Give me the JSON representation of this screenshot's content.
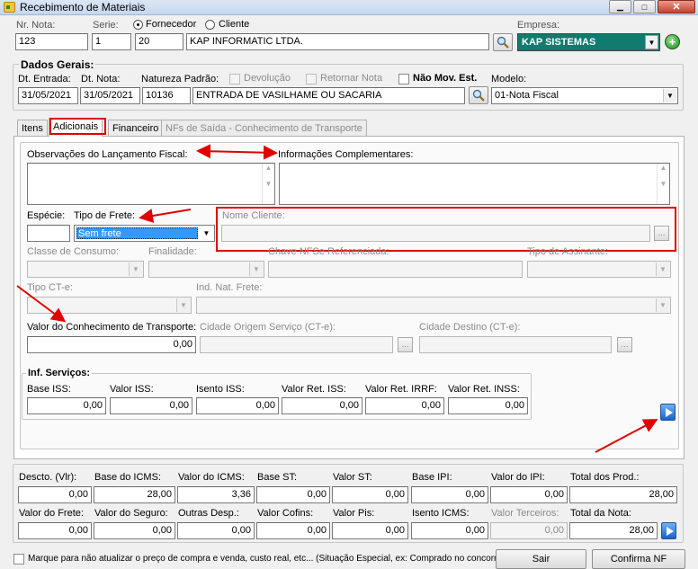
{
  "window": {
    "title": "Recebimento de Materiais"
  },
  "header": {
    "nr_nota_label": "Nr. Nota:",
    "nr_nota": "123",
    "serie_label": "Serie:",
    "serie": "1",
    "serie2": "20",
    "fornecedor_label": "Fornecedor",
    "cliente_label": "Cliente",
    "fornecedor_nome": "KAP INFORMATIC LTDA.",
    "empresa_label": "Empresa:",
    "empresa": "KAP SISTEMAS"
  },
  "dados_gerais": {
    "title": "Dados Gerais:",
    "dt_entrada_label": "Dt. Entrada:",
    "dt_entrada": "31/05/2021",
    "dt_nota_label": "Dt. Nota:",
    "dt_nota": "31/05/2021",
    "natureza_label": "Natureza Padrão:",
    "natureza_cod": "10136",
    "natureza_desc": "ENTRADA DE VASILHAME OU SACARIA",
    "devolucao_label": "Devolução",
    "retornar_label": "Retornar Nota",
    "nao_mov_label": "Não Mov. Est.",
    "modelo_label": "Modelo:",
    "modelo": "01-Nota Fiscal"
  },
  "tabs": [
    "Itens",
    "Adicionais",
    "Financeiro",
    "NFs de Saída - Conhecimento de Transporte"
  ],
  "adicionais": {
    "obs_label": "Observações do Lançamento Fiscal:",
    "info_label": "Informações Complementares:",
    "especie_label": "Espécie:",
    "frete_label": "Tipo de Frete:",
    "frete_value": "Sem frete",
    "nome_cliente_label": "Nome Cliente:",
    "classe_label": "Classe de Consumo:",
    "finalidade_label": "Finalidade:",
    "chave_label": "Chave NFSe Referenciada:",
    "assinante_label": "Tipo de Assinante:",
    "tipo_cte_label": "Tipo CT-e:",
    "ind_nat_label": "Ind. Nat. Frete:",
    "valor_cte_label": "Valor do Conhecimento de Transporte:",
    "valor_cte": "0,00",
    "cidade_origem_label": "Cidade Origem Serviço (CT-e):",
    "cidade_destino_label": "Cidade Destino (CT-e):"
  },
  "inf_servicos": {
    "title": "Inf. Serviços:",
    "fields": [
      {
        "label": "Base ISS:",
        "value": "0,00"
      },
      {
        "label": "Valor ISS:",
        "value": "0,00"
      },
      {
        "label": "Isento ISS:",
        "value": "0,00"
      },
      {
        "label": "Valor Ret. ISS:",
        "value": "0,00"
      },
      {
        "label": "Valor Ret. IRRF:",
        "value": "0,00"
      },
      {
        "label": "Valor Ret. INSS:",
        "value": "0,00"
      }
    ]
  },
  "totais": {
    "row1": [
      {
        "label": "Descto. (Vlr):",
        "value": "0,00"
      },
      {
        "label": "Base do ICMS:",
        "value": "28,00"
      },
      {
        "label": "Valor do ICMS:",
        "value": "3,36"
      },
      {
        "label": "Base ST:",
        "value": "0,00"
      },
      {
        "label": "Valor ST:",
        "value": "0,00"
      },
      {
        "label": "Base IPI:",
        "value": "0,00"
      },
      {
        "label": "Valor do IPI:",
        "value": "0,00"
      },
      {
        "label": "Total dos Prod.:",
        "value": "28,00"
      }
    ],
    "row2": [
      {
        "label": "Valor do Frete:",
        "value": "0,00"
      },
      {
        "label": "Valor do Seguro:",
        "value": "0,00"
      },
      {
        "label": "Outras Desp.:",
        "value": "0,00"
      },
      {
        "label": "Valor Cofins:",
        "value": "0,00"
      },
      {
        "label": "Valor Pis:",
        "value": "0,00"
      },
      {
        "label": "Isento ICMS:",
        "value": "0,00"
      },
      {
        "label": "Valor Terceiros:",
        "value": "0,00"
      },
      {
        "label": "Total da Nota:",
        "value": "28,00"
      }
    ]
  },
  "footer": {
    "check_label": "Marque para não atualizar o preço de compra e venda, custo real, etc... (Situação Especial, ex: Comprado no concorrente)",
    "sair": "Sair",
    "confirma": "Confirma NF"
  },
  "colors": {
    "empresa_bg": "#127a6e",
    "selection": "#3399ff",
    "annotation": "#e00000"
  }
}
